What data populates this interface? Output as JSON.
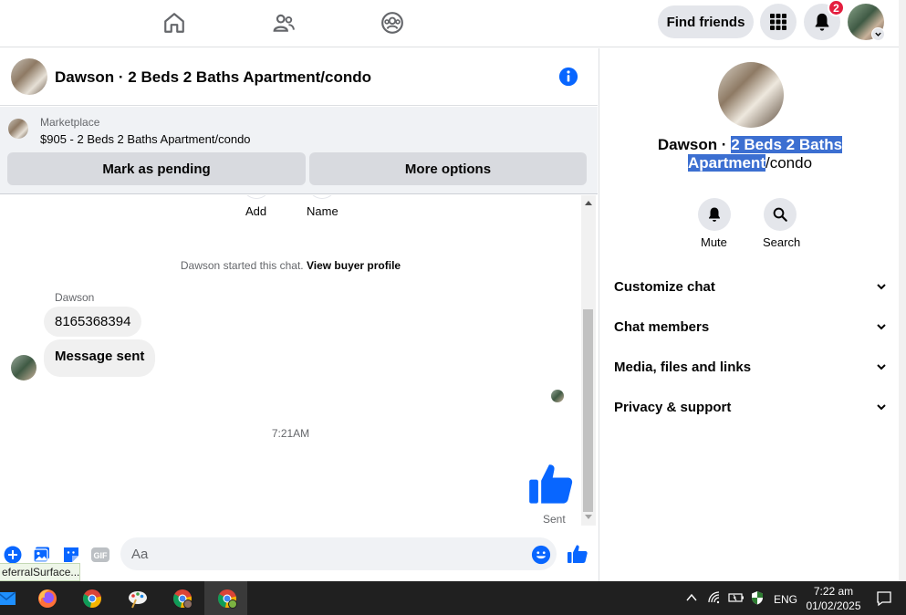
{
  "topbar": {
    "find_friends_label": "Find friends",
    "notification_count": "2",
    "nav_icons": [
      "home-icon",
      "friends-icon",
      "groups-icon"
    ]
  },
  "chat": {
    "title": "Dawson · 2 Beds 2 Baths Apartment/condo"
  },
  "marketplace": {
    "label": "Marketplace",
    "item": "$905 - 2 Beds 2 Baths Apartment/condo",
    "pending_button": "Mark as pending",
    "options_button": "More options"
  },
  "messages": {
    "actions": [
      "Add",
      "Name"
    ],
    "system_prefix": "Dawson started this chat. ",
    "system_link": "View buyer profile",
    "sender": "Dawson",
    "bubbles": [
      "8165368394",
      "Message sent"
    ],
    "timestamp": "7:21AM",
    "sent_label": "Sent"
  },
  "composer": {
    "placeholder": "Aa",
    "gif_label": "GIF",
    "tooltip": "eferralSurface..."
  },
  "right_panel": {
    "title_prefix": "Dawson · ",
    "title_selected_1": "2 Beds 2 Baths",
    "title_selected_2": "Apartment",
    "title_suffix": "/condo",
    "mute_label": "Mute",
    "search_label": "Search",
    "sections": [
      "Customize chat",
      "Chat members",
      "Media, files and links",
      "Privacy & support"
    ]
  },
  "taskbar": {
    "language": "ENG",
    "time": "7:22 am",
    "date": "01/02/2025"
  },
  "colors": {
    "accent": "#0866ff",
    "selection": "#3c6fd1",
    "badge": "#e41e3f"
  }
}
